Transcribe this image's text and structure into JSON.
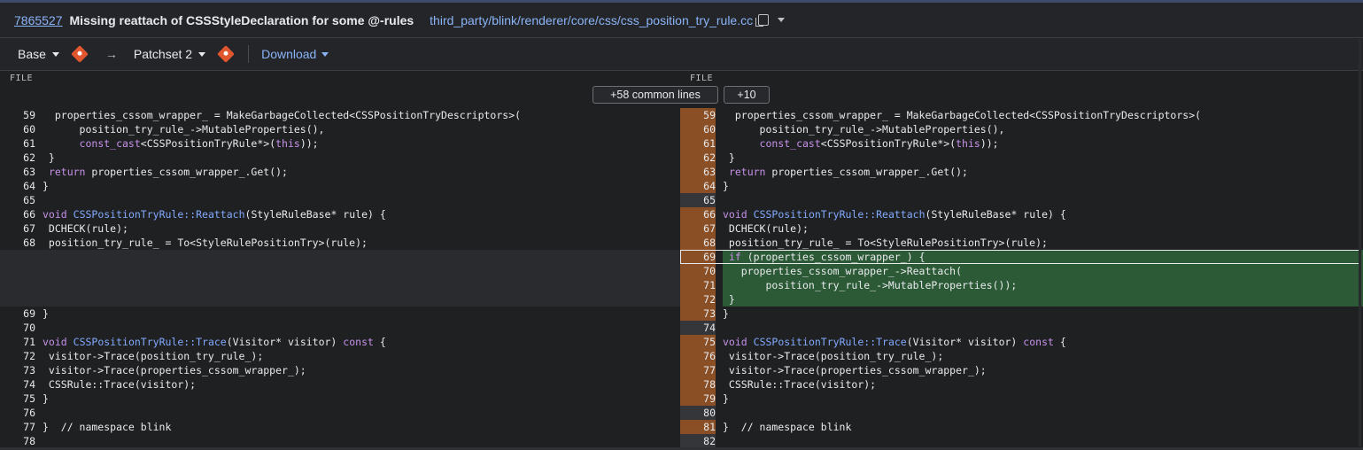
{
  "header": {
    "change_number": "7865527",
    "subject": "Missing reattach of CSSStyleDeclaration for some @-rules",
    "file_path": "third_party/blink/renderer/core/css/css_position_try_rule.cc"
  },
  "toolbar": {
    "base_label": "Base",
    "arrow": "→",
    "patchset_label": "Patchset 2",
    "download_label": "Download"
  },
  "file_headers": {
    "left": "FILE",
    "right": "FILE"
  },
  "expand": {
    "common": "+58 common lines",
    "more": "+10"
  },
  "left_lines": [
    {
      "n": "59",
      "t": "  properties_cssom_wrapper_ = MakeGarbageCollected<CSSPositionTryDescriptors>("
    },
    {
      "n": "60",
      "t": "      position_try_rule_->MutableProperties(),"
    },
    {
      "n": "61",
      "t": "      const_cast<CSSPositionTryRule*>(this));"
    },
    {
      "n": "62",
      "t": " }"
    },
    {
      "n": "63",
      "t": " return properties_cssom_wrapper_.Get();"
    },
    {
      "n": "64",
      "t": "}"
    },
    {
      "n": "65",
      "t": ""
    },
    {
      "n": "66",
      "t": "void CSSPositionTryRule::Reattach(StyleRuleBase* rule) {"
    },
    {
      "n": "67",
      "t": " DCHECK(rule);"
    },
    {
      "n": "68",
      "t": " position_try_rule_ = To<StyleRulePositionTry>(rule);"
    },
    {
      "n": "",
      "t": ""
    },
    {
      "n": "",
      "t": ""
    },
    {
      "n": "",
      "t": ""
    },
    {
      "n": "",
      "t": ""
    },
    {
      "n": "69",
      "t": "}"
    },
    {
      "n": "70",
      "t": ""
    },
    {
      "n": "71",
      "t": "void CSSPositionTryRule::Trace(Visitor* visitor) const {"
    },
    {
      "n": "72",
      "t": " visitor->Trace(position_try_rule_);"
    },
    {
      "n": "73",
      "t": " visitor->Trace(properties_cssom_wrapper_);"
    },
    {
      "n": "74",
      "t": " CSSRule::Trace(visitor);"
    },
    {
      "n": "75",
      "t": "}"
    },
    {
      "n": "76",
      "t": ""
    },
    {
      "n": "77",
      "t": "}  // namespace blink"
    },
    {
      "n": "78",
      "t": ""
    }
  ],
  "right_lines": [
    {
      "n": "59",
      "t": "  properties_cssom_wrapper_ = MakeGarbageCollected<CSSPositionTryDescriptors>("
    },
    {
      "n": "60",
      "t": "      position_try_rule_->MutableProperties(),"
    },
    {
      "n": "61",
      "t": "      const_cast<CSSPositionTryRule*>(this));"
    },
    {
      "n": "62",
      "t": " }"
    },
    {
      "n": "63",
      "t": " return properties_cssom_wrapper_.Get();"
    },
    {
      "n": "64",
      "t": "}"
    },
    {
      "n": "65",
      "t": ""
    },
    {
      "n": "66",
      "t": "void CSSPositionTryRule::Reattach(StyleRuleBase* rule) {"
    },
    {
      "n": "67",
      "t": " DCHECK(rule);"
    },
    {
      "n": "68",
      "t": " position_try_rule_ = To<StyleRulePositionTry>(rule);"
    },
    {
      "n": "69",
      "t": " if (properties_cssom_wrapper_) {"
    },
    {
      "n": "70",
      "t": "   properties_cssom_wrapper_->Reattach("
    },
    {
      "n": "71",
      "t": "       position_try_rule_->MutableProperties());"
    },
    {
      "n": "72",
      "t": " }"
    },
    {
      "n": "73",
      "t": "}"
    },
    {
      "n": "74",
      "t": ""
    },
    {
      "n": "75",
      "t": "void CSSPositionTryRule::Trace(Visitor* visitor) const {"
    },
    {
      "n": "76",
      "t": " visitor->Trace(position_try_rule_);"
    },
    {
      "n": "77",
      "t": " visitor->Trace(properties_cssom_wrapper_);"
    },
    {
      "n": "78",
      "t": " CSSRule::Trace(visitor);"
    },
    {
      "n": "79",
      "t": "}"
    },
    {
      "n": "80",
      "t": ""
    },
    {
      "n": "81",
      "t": "}  // namespace blink"
    },
    {
      "n": "82",
      "t": ""
    }
  ],
  "colors": {
    "added_bg": "#2c5a36",
    "changed_line_number_bg": "#8a4f25",
    "link": "#8ab4f8",
    "keyword": "#c792ea",
    "function": "#82aaff"
  }
}
